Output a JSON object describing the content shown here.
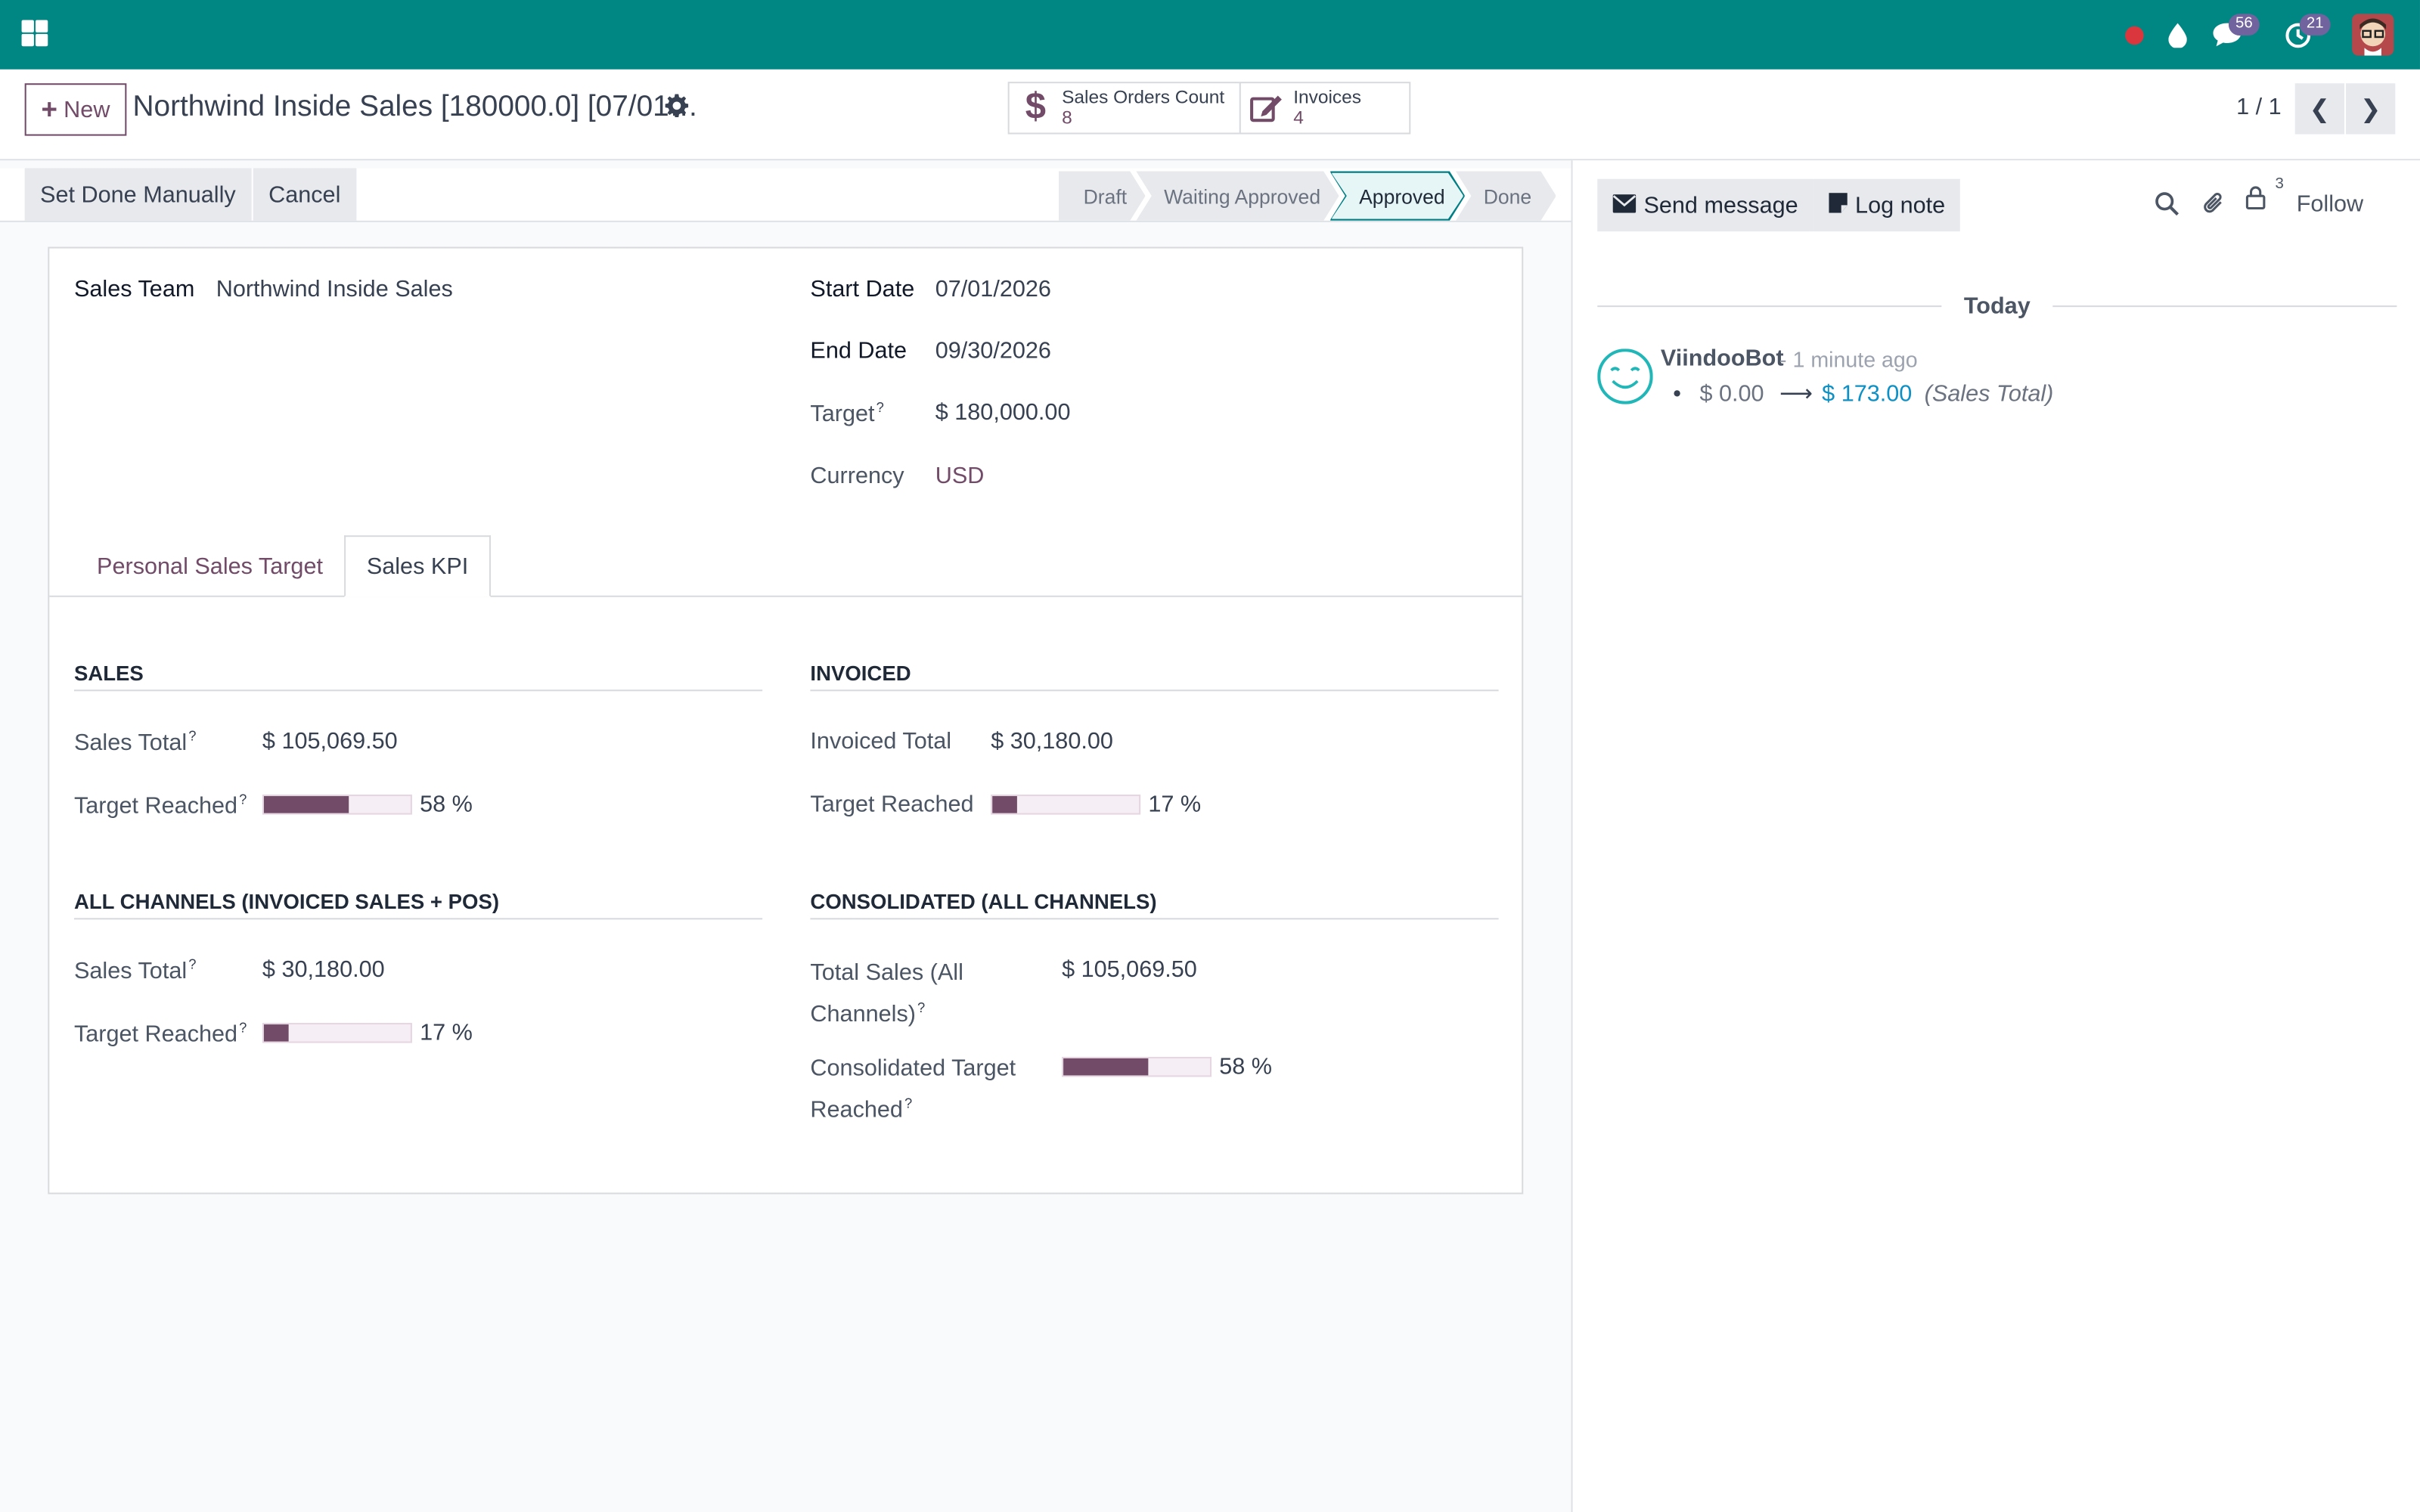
{
  "navbar": {
    "notification_count": "56",
    "activity_count": "21"
  },
  "control_panel": {
    "new_label": "New",
    "record_title": "Northwind Inside Sales [180000.0] [07/01…",
    "smart_buttons": [
      {
        "label": "Sales Orders Count",
        "value": "8",
        "icon": "dollar-icon"
      },
      {
        "label": "Invoices",
        "value": "4",
        "icon": "pencil-square-icon"
      }
    ],
    "pager": "1 / 1"
  },
  "statusbar": {
    "buttons": [
      "Set Done Manually",
      "Cancel"
    ],
    "stages": [
      "Draft",
      "Waiting Approved",
      "Approved",
      "Done"
    ],
    "current_stage": "Approved"
  },
  "form": {
    "sales_team_label": "Sales Team",
    "sales_team_value": "Northwind Inside Sales",
    "start_date_label": "Start Date",
    "start_date_value": "07/01/2026",
    "end_date_label": "End Date",
    "end_date_value": "09/30/2026",
    "target_label": "Target",
    "target_value": "$ 180,000.00",
    "currency_label": "Currency",
    "currency_value": "USD",
    "tabs": [
      "Personal Sales Target",
      "Sales KPI"
    ],
    "active_tab": "Sales KPI",
    "sections": {
      "sales": {
        "title": "SALES",
        "total_label": "Sales Total",
        "total_value": "$ 105,069.50",
        "reached_label": "Target Reached",
        "reached_pct": 58,
        "reached_text": "58 %"
      },
      "invoiced": {
        "title": "INVOICED",
        "total_label": "Invoiced Total",
        "total_value": "$ 30,180.00",
        "reached_label": "Target Reached",
        "reached_pct": 17,
        "reached_text": "17 %"
      },
      "all_channels": {
        "title": "ALL CHANNELS (INVOICED SALES + POS)",
        "total_label": "Sales Total",
        "total_value": "$ 30,180.00",
        "reached_label": "Target Reached",
        "reached_pct": 17,
        "reached_text": "17 %"
      },
      "consolidated": {
        "title": "CONSOLIDATED (ALL CHANNELS)",
        "total_label_1": "Total Sales (All",
        "total_label_2": "Channels)",
        "total_value": "$ 105,069.50",
        "reached_label_1": "Consolidated Target",
        "reached_label_2": "Reached",
        "reached_pct": 58,
        "reached_text": "58 %"
      }
    }
  },
  "chatter": {
    "send_message": "Send message",
    "log_note": "Log note",
    "followers_count": "3",
    "follow_label": "Follow",
    "date_separator": "Today",
    "message": {
      "author": "ViindooBot",
      "time": "- 1 minute ago",
      "old_value": "$ 0.00",
      "new_value": "$ 173.00",
      "field": "(Sales Total)"
    }
  },
  "colors": {
    "navbar": "#008784",
    "brand": "#714b67",
    "stage_current": "#017e84",
    "link_blue": "#0d90c5"
  }
}
